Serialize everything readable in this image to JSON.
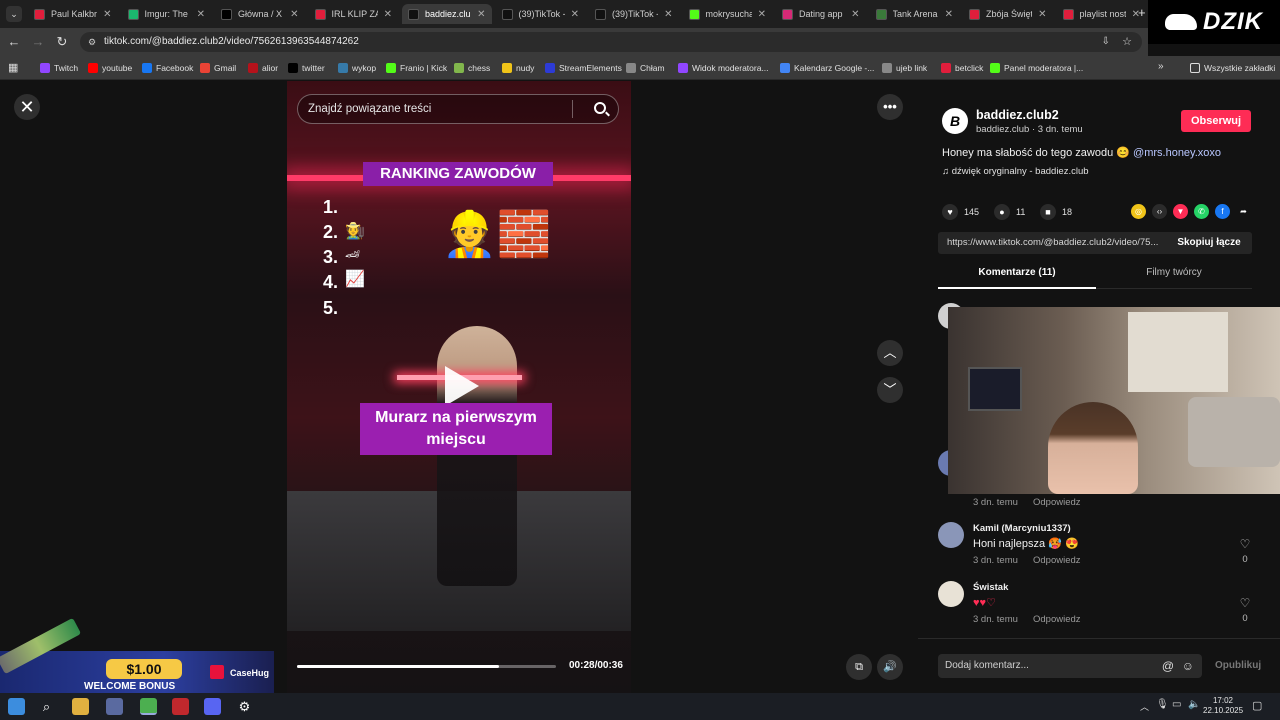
{
  "browser": {
    "tabs": [
      {
        "title": "Paul Kalkbre",
        "color": "#e01e3c"
      },
      {
        "title": "Imgur: The m",
        "color": "#1bb76e"
      },
      {
        "title": "Główna / X",
        "color": "#000000"
      },
      {
        "title": "IRL KLIP ZA",
        "color": "#e01e3c"
      },
      {
        "title": "baddiez.club",
        "color": "#111111",
        "active": true
      },
      {
        "title": "(39)TikTok -",
        "color": "#111111"
      },
      {
        "title": "(39)TikTok -",
        "color": "#111111"
      },
      {
        "title": "mokrysucha",
        "color": "#53fc18"
      },
      {
        "title": "Dating app p",
        "color": "#d62976"
      },
      {
        "title": "Tank Arena",
        "color": "#3a7a3a"
      },
      {
        "title": "Zbója Święto",
        "color": "#e01e3c"
      },
      {
        "title": "playlist nosta",
        "color": "#e01e3c"
      }
    ],
    "url": "tiktok.com/@baddiez.club2/video/7562613963544874262",
    "overlay_logo": "DZIK",
    "bookmarks": [
      {
        "label": "Twitch",
        "color": "#9146ff"
      },
      {
        "label": "youtube",
        "color": "#ff0000"
      },
      {
        "label": "Facebook",
        "color": "#1877f2"
      },
      {
        "label": "Gmail",
        "color": "#ea4335"
      },
      {
        "label": "alior",
        "color": "#b5121b"
      },
      {
        "label": "twitter",
        "color": "#000000"
      },
      {
        "label": "wykop",
        "color": "#367aa9"
      },
      {
        "label": "Franio | Kick",
        "color": "#53fc18"
      },
      {
        "label": "chess",
        "color": "#81b64c"
      },
      {
        "label": "nudy",
        "color": "#f0c419"
      },
      {
        "label": "StreamElements",
        "color": "#2d3bd6"
      },
      {
        "label": "Chłam",
        "color": "#888888"
      },
      {
        "label": "Widok moderatora...",
        "color": "#9146ff"
      },
      {
        "label": "Kalendarz Google -...",
        "color": "#4285f4"
      },
      {
        "label": "ujeb link",
        "color": "#888888"
      },
      {
        "label": "betclick",
        "color": "#e01e3c"
      },
      {
        "label": "Panel moderatora |...",
        "color": "#53fc18"
      }
    ],
    "all_bookmarks": "Wszystkie zakładki"
  },
  "video": {
    "search_placeholder": "Znajdź powiązane treści",
    "ranking_title": "RANKING ZAWODÓW",
    "ranking_numbers": [
      "1.",
      "2.",
      "3.",
      "4.",
      "5."
    ],
    "caption": "Murarz na pierwszym miejscu",
    "time": "00:28/00:36",
    "progress": 0.78
  },
  "ad": {
    "amount": "$1.00",
    "bonus": "WELCOME BONUS",
    "brand": "CaseHug"
  },
  "panel": {
    "author_name": "baddiez.club2",
    "author_meta": "baddiez.club · 3 dn. temu",
    "follow_label": "Obserwuj",
    "description": "Honey ma słabość do tego zawodu 😊",
    "mention": "@mrs.honey.xoxo",
    "sound": "♫  dźwięk oryginalny - baddiez.club",
    "likes": "145",
    "comments": "11",
    "saves": "18",
    "link": "https://www.tiktok.com/@baddiez.club2/video/75...",
    "copy_label": "Skopiuj łącze",
    "tab_comments": "Komentarze (11)",
    "tab_creator": "Filmy twórcy",
    "comment_list": [
      {
        "name": "",
        "text": "",
        "time": "3 dn. temu",
        "reply": "Odpowiedz",
        "likes": ""
      },
      {
        "name": "Kamil (Marcyniu1337)",
        "text": "Honi najlepsza 🥵 😍",
        "time": "3 dn. temu",
        "reply": "Odpowiedz",
        "likes": "0"
      },
      {
        "name": "Świstak",
        "text": "♥♥♡",
        "time": "3 dn. temu",
        "reply": "Odpowiedz",
        "likes": "0"
      }
    ],
    "add_comment_placeholder": "Dodaj komentarz...",
    "publish_label": "Opublikuj"
  },
  "taskbar": {
    "time": "17:02",
    "date": "22.10.2025"
  }
}
